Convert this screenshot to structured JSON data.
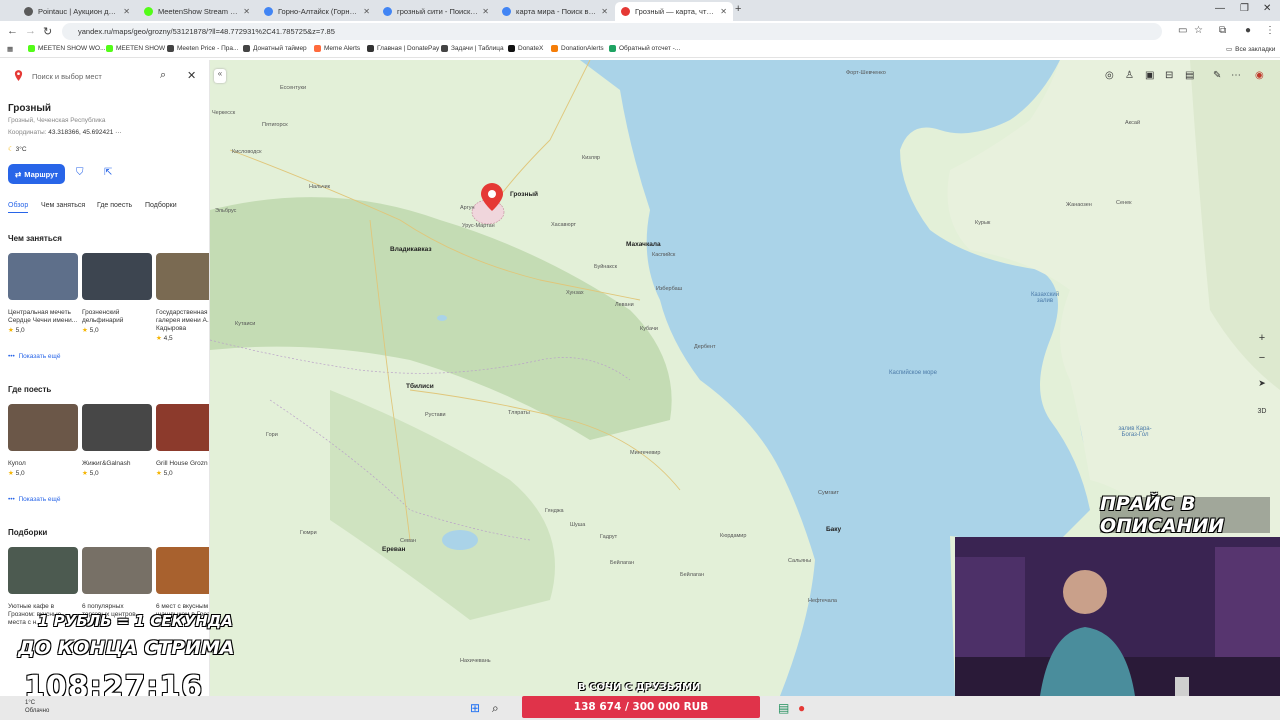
{
  "browser": {
    "tabs": [
      {
        "label": "Pointauc | Аукцион для стрим",
        "color": "#5a5a5a"
      },
      {
        "label": "MeetenShow Stream - Watch I",
        "color": "#53fc18"
      },
      {
        "label": "Горно-Алтайск (Горный Алтай",
        "color": "#4285f4"
      },
      {
        "label": "грозный сити - Поиск в Goog",
        "color": "#4285f4"
      },
      {
        "label": "карта мира - Поиск в Google",
        "color": "#4285f4"
      },
      {
        "label": "Грозный — карта, что посмот",
        "color": "#e53935"
      }
    ],
    "new_tab": "+",
    "url": "yandex.ru/maps/geo/grozny/53121878/?ll=48.772931%2C41.785725&z=7.85",
    "bookmarks": [
      {
        "label": "MEETEN SHOW WO...",
        "color": "#53fc18"
      },
      {
        "label": "MEETEN SHOW",
        "color": "#53fc18"
      },
      {
        "label": "Meeten Price - Пра...",
        "color": "#444444"
      },
      {
        "label": "Донатный таймер",
        "color": "#444444"
      },
      {
        "label": "Meme Alerts",
        "color": "#ff6b3d"
      },
      {
        "label": "Главная | DonatePay",
        "color": "#333333"
      },
      {
        "label": "Задачи | Таблица",
        "color": "#444444"
      },
      {
        "label": "DonateX",
        "color": "#111111"
      },
      {
        "label": "DonationAlerts",
        "color": "#f57d07"
      },
      {
        "label": "Обратный отсчет -...",
        "color": "#1ea362"
      }
    ],
    "all_bookmarks": "Все закладки"
  },
  "panel": {
    "search_placeholder": "Поиск и выбор мест",
    "title": "Грозный",
    "subtitle": "Грозный, Чеченская Республика",
    "coords_label": "Координаты:",
    "coords_value": "43.318366, 45.692421",
    "weather": "3°C",
    "route_label": "Маршрут",
    "tabs": [
      "Обзор",
      "Чем заняться",
      "Где поесть",
      "Подборки"
    ],
    "sections": {
      "todo": {
        "title": "Чем заняться",
        "cards": [
          {
            "name": "Центральная мечеть Сердце Чечни имени...",
            "rating": "5,0",
            "color": "#5e6f8a"
          },
          {
            "name": "Грозненский дельфинарий",
            "rating": "5,0",
            "color": "#3d4550"
          },
          {
            "name": "Государственная галерея имени А.А. Кадырова",
            "rating": "4,5",
            "color": "#7a6a52"
          }
        ],
        "more": "Показать ещё"
      },
      "food": {
        "title": "Где поесть",
        "cards": [
          {
            "name": "Купол",
            "rating": "5,0",
            "color": "#6b5748"
          },
          {
            "name": "Жижиг&Galnash",
            "rating": "5,0",
            "color": "#474747"
          },
          {
            "name": "Grill House Grozn",
            "rating": "5,0",
            "color": "#8c3a2c"
          }
        ],
        "more": "Показать ещё"
      },
      "collections": {
        "title": "Подборки",
        "cards": [
          {
            "name": "Уютные кафе в Грозном: вкусные места с н...",
            "color": "#4c5a50"
          },
          {
            "name": "6 популярных торговых центров",
            "color": "#777066"
          },
          {
            "name": "6 мест с вкусным шашлыком в Грозном",
            "color": "#a8612e"
          }
        ]
      }
    }
  },
  "map": {
    "pin_label": "Грозный",
    "cities": [
      "Владикавказ",
      "Тбилиси",
      "Ереван",
      "Махачкала",
      "Баку",
      "Каспийск",
      "Дербент",
      "Нальчик",
      "Хасавюрт"
    ],
    "labels": [
      "Форт-Шевченко",
      "Сенек",
      "Жанаозен",
      "Курык",
      "Аксай",
      "Кизляр",
      "Ессентуки",
      "Пятигорск",
      "Кисловодск",
      "Черкесск",
      "Эльбрус",
      "Гори",
      "Рустави",
      "Кутаиси",
      "Гянджа",
      "Сумгаит",
      "Бейлаган",
      "Избербаш",
      "Буйнакск",
      "Сальяны",
      "Кюрдамир",
      "Нахичевань",
      "Гадрут",
      "Шуша",
      "Гюмри",
      "Севан",
      "Урус-Мартан",
      "Аргун",
      "Хунзах",
      "Левани",
      "Кубачи",
      "Тляраты",
      "Нефтечала",
      "Бейлаган",
      "Мингечевир"
    ],
    "sea_label": "Каспийское море",
    "bay_label": "залив Кара-Богаз-Гол",
    "gulf_label": "Казахский залив",
    "zoom_in": "+",
    "zoom_out": "−",
    "mode_3d": "3D"
  },
  "stream": {
    "price_banner": "ПРАЙС В ОПИСАНИИ",
    "line1": "1 РУБЛЬ = 1 СЕКУНДА",
    "line2": "ДО КОНЦА СТРИМА",
    "timer": "108:27:16",
    "caption": "В СОЧИ С ДРУЗЬЯМИ",
    "goal": "138 674 / 300 000 RUB"
  },
  "taskbar": {
    "temp": "1°C",
    "weather": "Облачно"
  },
  "colors": {
    "accent": "#2865e8",
    "water": "#aad3e8",
    "land": "#dfefd6",
    "goal": "#e0334a"
  }
}
